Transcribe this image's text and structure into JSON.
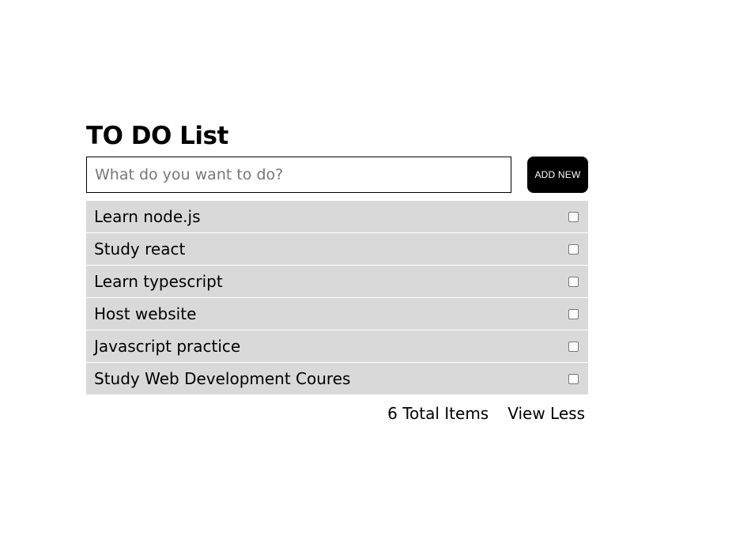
{
  "header": {
    "title": "TO DO List"
  },
  "form": {
    "input_placeholder": "What do you want to do?",
    "input_value": "",
    "add_button_label": "ADD NEW"
  },
  "todos": [
    {
      "text": "Learn node.js",
      "checked": false
    },
    {
      "text": "Study react",
      "checked": false
    },
    {
      "text": "Learn typescript",
      "checked": false
    },
    {
      "text": "Host website",
      "checked": false
    },
    {
      "text": "Javascript practice",
      "checked": false
    },
    {
      "text": "Study Web Development Coures",
      "checked": false
    }
  ],
  "footer": {
    "total_items": "6 Total Items",
    "view_toggle_label": "View Less"
  },
  "colors": {
    "item_background": "#d9d9d9",
    "button_background": "#000000",
    "button_text": "#ffffff"
  }
}
